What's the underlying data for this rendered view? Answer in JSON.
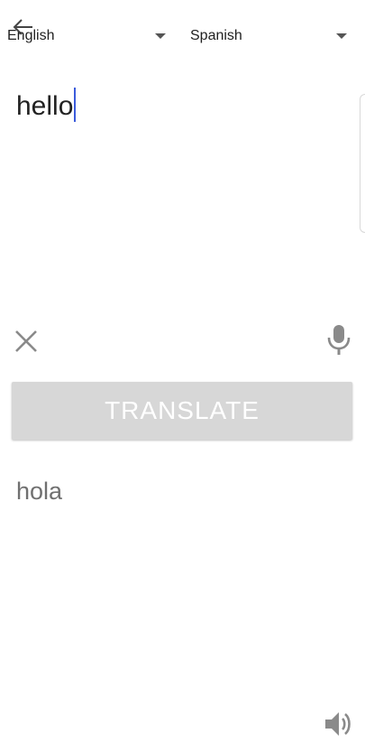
{
  "header": {
    "back_icon": "arrow-left-icon",
    "source_language": "English",
    "target_language": "Spanish",
    "dropdown_icon": "caret-down-icon"
  },
  "input": {
    "text": "hello"
  },
  "actions": {
    "clear_icon": "close-icon",
    "mic_icon": "microphone-icon",
    "translate_label": "TRANSLATE"
  },
  "output": {
    "text": "hola",
    "speaker_icon": "speaker-icon"
  },
  "colors": {
    "cursor": "#3b5bdb",
    "button_bg": "#d7d7d7",
    "icon_gray": "#8a8a8a",
    "output_text": "#707070"
  }
}
